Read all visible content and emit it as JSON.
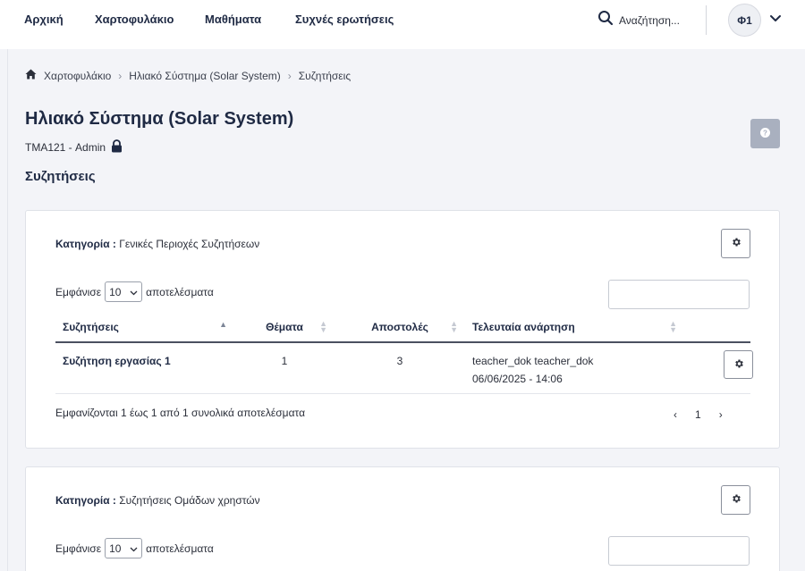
{
  "nav": {
    "items": [
      "Αρχική",
      "Χαρτοφυλάκιο",
      "Μαθήματα",
      "Συχνές ερωτήσεις"
    ],
    "search_placeholder": "Αναζήτηση...",
    "avatar_initials": "Φ1"
  },
  "breadcrumb": [
    "Χαρτοφυλάκιο",
    "Ηλιακό Σύστημα (Solar System)",
    "Συζητήσεις"
  ],
  "course": {
    "title": "Ηλιακό Σύστημα (Solar System)",
    "subtitle": "ΤΜΑ121 - Admin"
  },
  "section_title": "Συζητήσεις",
  "categories": [
    {
      "label": "Κατηγορία :",
      "name": "Γενικές Περιοχές Συζητήσεων",
      "show_prefix": "Εμφάνισε",
      "page_size": "10",
      "show_suffix": "αποτελέσματα",
      "columns": [
        "Συζητήσεις",
        "Θέματα",
        "Αποστολές",
        "Τελευταία ανάρτηση"
      ],
      "rows": [
        {
          "forum": "Συζήτηση εργασίας 1",
          "topics": "1",
          "posts": "3",
          "last_user": "teacher_dok teacher_dok",
          "last_date": "06/06/2025 - 14:06"
        }
      ],
      "info": "Εμφανίζονται 1 έως 1 από 1 συνολικά αποτελέσματα",
      "pager": {
        "prev": "‹",
        "page": "1",
        "next": "›"
      }
    },
    {
      "label": "Κατηγορία :",
      "name": "Συζητήσεις Ομάδων χρηστών",
      "show_prefix": "Εμφάνισε",
      "page_size": "10",
      "show_suffix": "αποτελέσματα"
    }
  ],
  "colors": {
    "primary_text": "#1f2a44",
    "help_button": "#a9b0bf",
    "background": "#f3f4f8"
  }
}
